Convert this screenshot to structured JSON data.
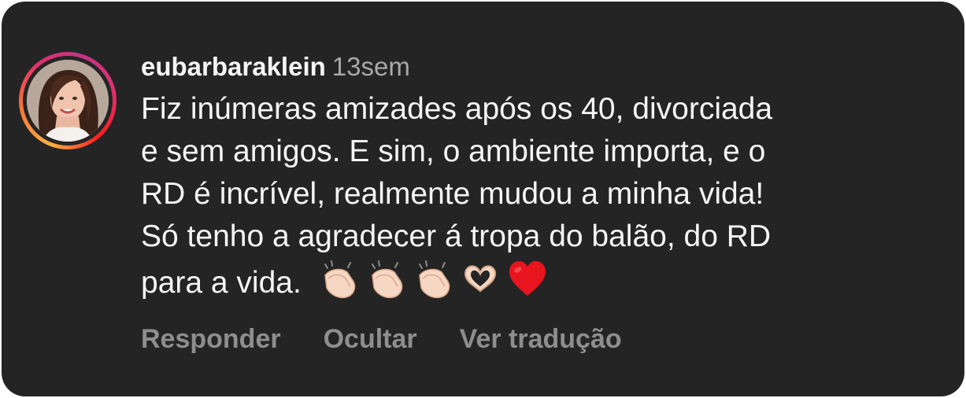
{
  "comment": {
    "username": "eubarbaraklein",
    "timestamp": "13sem",
    "lines": [
      "Fiz inúmeras amizades após os 40, divorciada",
      "e sem amigos. E sim, o ambiente importa, e o",
      "RD é incrível, realmente mudou a minha vida!",
      "Só tenho a agradecer á tropa do balão, do RD",
      "para a vida."
    ],
    "emojis": [
      "clapping-hands",
      "clapping-hands",
      "clapping-hands",
      "heart-hands",
      "red-heart"
    ]
  },
  "actions": {
    "reply": "Responder",
    "hide": "Ocultar",
    "translate": "Ver tradução"
  },
  "colors": {
    "background": "#242424",
    "text": "#f5f5f5",
    "muted": "#a8a8a8",
    "action": "#8e8e8e"
  }
}
